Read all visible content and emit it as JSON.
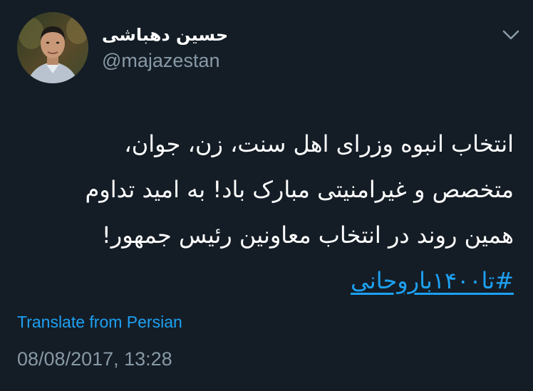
{
  "author": {
    "display_name": "حسین دهباشی",
    "handle": "@majazestan",
    "avatar_icon": "profile-photo"
  },
  "tweet": {
    "lines": [
      "انتخاب انبوه وزرای اهل سنت، زن، جوان،",
      "متخصص و غیرامنیتی مبارک باد! به امید تداوم",
      "همین روند در انتخاب معاونین رئیس جمهور!"
    ],
    "hashtag": "#تا۱۴۰۰باروحانی"
  },
  "translate_label": "Translate from Persian",
  "timestamp": "08/08/2017, 13:28",
  "menu_icon": "chevron-down-icon",
  "colors": {
    "background": "#141d26",
    "text_primary": "#ffffff",
    "text_secondary": "#8899a6",
    "link": "#1da1f2"
  }
}
